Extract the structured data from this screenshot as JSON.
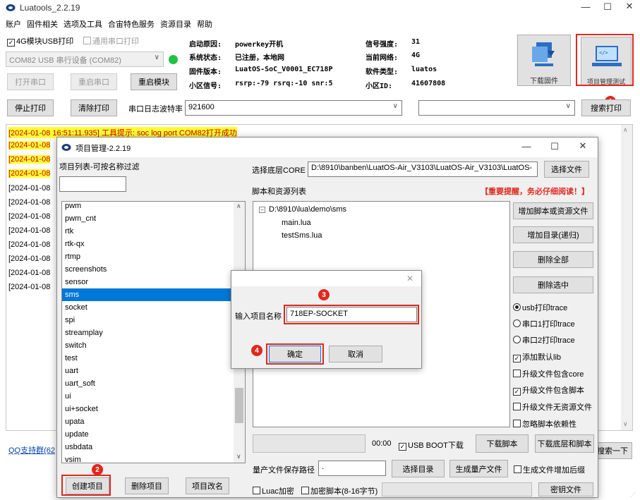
{
  "app": {
    "title": "Luatools_2.2.19"
  },
  "menu": [
    "账户",
    "固件相关",
    "选项及工具",
    "合宙特色服务",
    "资源目录",
    "帮助"
  ],
  "toolbar": {
    "chk_usb_print": "4G模块USB打印",
    "chk_uart_print": "通用串口打印",
    "port_select": "COM82 USB 串行设备 (COM82)",
    "open_port": "打开串口",
    "restart_port": "重启串口",
    "restart_module": "重启模块",
    "stop_print": "停止打印",
    "clear_print": "清除打印",
    "baud_label": "串口日志波特率",
    "baud_value": "921600",
    "search_print": "搜索打印",
    "download_firmware": "下载固件",
    "project_mgmt": "项目管理测试"
  },
  "device_info": {
    "boot_reason_label": "启动原因:",
    "boot_reason": "powerkey开机",
    "system_status_label": "系统状态:",
    "system_status": "已注册，本地网",
    "firmware_label": "固件版本:",
    "firmware": "LuatOS-SoC_V0001_EC718P",
    "cell_label": "小区信号:",
    "cell": "rsrp:-79 rsrq:-10 snr:5",
    "signal_label": "信号强度:",
    "signal": "31",
    "network_label": "当前网络:",
    "network": "4G",
    "software_label": "软件类型:",
    "software": "luatos",
    "cell_id_label": "小区ID:",
    "cell_id": "41607808"
  },
  "log": {
    "first_line": "[2024-01-08 16:51:11.935] 工具提示: soc log port COM82打开成功",
    "prefix": "[2024-01-08",
    "qq_link": "QQ支持群(62",
    "search_one": "搜索一下"
  },
  "pm": {
    "title": "项目管理-2.2.19",
    "list_label": "项目列表-可按名称过滤",
    "projects": [
      "pwm",
      "pwm_cnt",
      "rtk",
      "rtk-qx",
      "rtmp",
      "screenshots",
      "sensor",
      "sms",
      "socket",
      "spi",
      "streamplay",
      "switch",
      "test",
      "uart",
      "uart_soft",
      "ui",
      "ui+socket",
      "upata",
      "update",
      "usbdata",
      "vsim"
    ],
    "selected_project": "sms",
    "core_label": "选择底层CORE",
    "core_path": "D:\\8910\\banben\\LuatOS-Air_V3103\\LuatOS-Air_V3103\\LuatOS-",
    "select_file": "选择文件",
    "scripts_label": "脚本和资源列表",
    "warning": "【重要提醒，务必仔细阅读！】",
    "tree_root": "D:\\8910\\lua\\demo\\sms",
    "tree_files": [
      "main.lua",
      "testSms.lua"
    ],
    "add_script": "增加脚本或资源文件",
    "add_dir": "增加目录(递归)",
    "delete_all": "删除全部",
    "delete_selected": "删除选中",
    "opt_usb_trace": "usb打印trace",
    "opt_uart1_trace": "串口1打印trace",
    "opt_uart2_trace": "串口2打印trace",
    "opt_add_lib": "添加默认lib",
    "opt_upgrade_core": "升级文件包含core",
    "opt_upgrade_script": "升级文件包含脚本",
    "opt_upgrade_nores": "升级文件无资源文件",
    "opt_ignore_deps": "忽略脚本依赖性",
    "time": "00:00",
    "usb_boot": "USB BOOT下载",
    "download_script": "下载脚本",
    "download_core_script": "下载底层和脚本",
    "mass_path_label": "量产文件保存路径",
    "mass_path_value": ".",
    "select_dir": "选择目录",
    "generate_mass": "生成量产文件",
    "suffix_opt": "生成文件增加后缀",
    "luac_encrypt": "Luac加密",
    "encrypt_script": "加密脚本(8-16字节)",
    "key_file": "密钥文件",
    "create_project": "创建项目",
    "delete_project": "删除项目",
    "rename_project": "项目改名"
  },
  "dialog": {
    "label": "输入项目名称",
    "value": "718EP-SOCKET",
    "ok": "确定",
    "cancel": "取消"
  },
  "badges": [
    "1",
    "2",
    "3",
    "4"
  ],
  "colors": {
    "accent": "#0078d7",
    "highlight": "#ff3",
    "annotation": "#e0281e",
    "status_dot": "#21c141"
  }
}
